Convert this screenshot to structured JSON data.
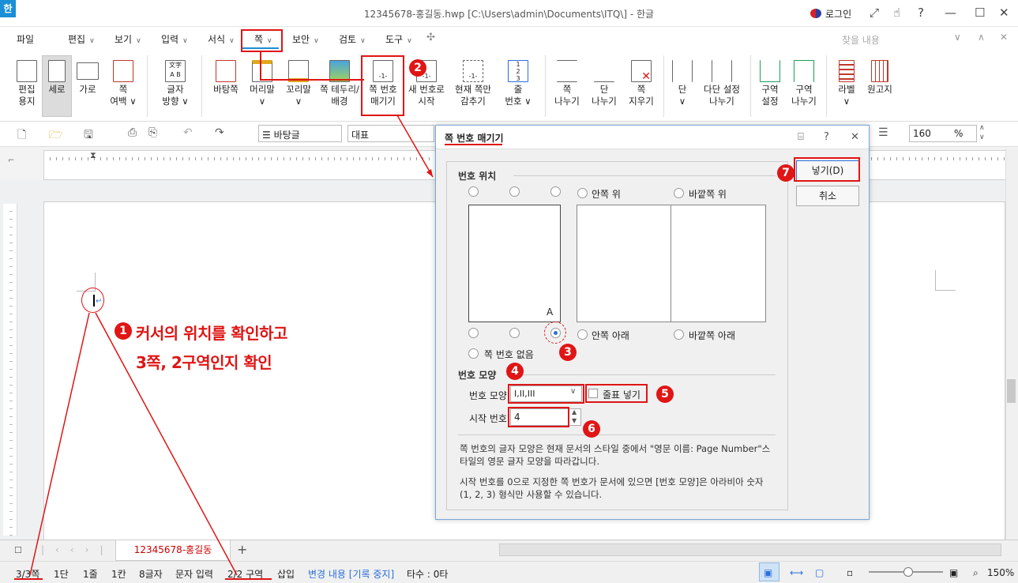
{
  "window": {
    "app_icon": "한",
    "title": "12345678-홍길동.hwp [C:\\Users\\admin\\Documents\\ITQ\\] - 한글",
    "login": "로그인",
    "help": "?"
  },
  "menu": [
    "파일",
    "편집",
    "보기",
    "입력",
    "서식",
    "쪽",
    "보안",
    "검토",
    "도구"
  ],
  "search_placeholder": "찾을 내용",
  "ribbon": [
    {
      "l1": "편집",
      "l2": "용지"
    },
    {
      "l1": "세로",
      "l2": ""
    },
    {
      "l1": "가로",
      "l2": ""
    },
    {
      "l1": "쪽",
      "l2": "여백"
    },
    {
      "l1": "글자",
      "l2": "방향"
    },
    {
      "l1": "바탕쪽",
      "l2": ""
    },
    {
      "l1": "머리말",
      "l2": ""
    },
    {
      "l1": "꼬리말",
      "l2": ""
    },
    {
      "l1": "쪽 테두리/",
      "l2": "배경"
    },
    {
      "l1": "쪽 번호",
      "l2": "매기기"
    },
    {
      "l1": "새 번호로",
      "l2": "시작"
    },
    {
      "l1": "현재 쪽만",
      "l2": "감추기"
    },
    {
      "l1": "줄",
      "l2": "번호"
    },
    {
      "l1": "쪽",
      "l2": "나누기"
    },
    {
      "l1": "단",
      "l2": "나누기"
    },
    {
      "l1": "쪽",
      "l2": "지우기"
    },
    {
      "l1": "단",
      "l2": ""
    },
    {
      "l1": "다단 설정",
      "l2": "나누기"
    },
    {
      "l1": "구역",
      "l2": "설정"
    },
    {
      "l1": "구역",
      "l2": "나누기"
    },
    {
      "l1": "라벨",
      "l2": ""
    },
    {
      "l1": "원고지",
      "l2": ""
    }
  ],
  "toolbar": {
    "style_combo": "바탕글",
    "font_combo": "대표",
    "zoom_value": "160",
    "zoom_unit": "%"
  },
  "dialog": {
    "title": "쪽 번호 매기기",
    "insert_button": "넣기(D)",
    "cancel_button": "취소",
    "position_group": "번호 위치",
    "inner_top": "안쪽 위",
    "outer_top": "바깥쪽 위",
    "inner_bottom": "안쪽 아래",
    "outer_bottom": "바깥쪽 아래",
    "no_number": "쪽 번호 없음",
    "preview_mark": "A",
    "shape_group": "번호 모양",
    "shape_label": "번호 모양",
    "shape_value": "I,II,III",
    "dash_checkbox": "줄표 넣기",
    "start_label": "시작 번호",
    "start_value": "4",
    "note1a": "쪽 번호의 글자 모양은 현재 문서의 스타일 중에서 \"영문 이름: Page Number\"스",
    "note1b": "타일의 영문 글자 모양을 따라갑니다.",
    "note2a": "시작 번호를 0으로 지정한 쪽 번호가 문서에 있으면 [번호 모양]은 아라비아 숫자",
    "note2b": "(1, 2, 3) 형식만 사용할 수 있습니다."
  },
  "annotations": {
    "b1": "1",
    "b2": "2",
    "b3": "3",
    "b4": "4",
    "b5": "5",
    "b6": "6",
    "b7": "7",
    "text1": "커서의 위치를 확인하고",
    "text2": "3쪽, 2구역인지 확인"
  },
  "doc_tab": "12345678-홍길동",
  "status": {
    "page": "3/3쪽",
    "col": "1단",
    "line": "1줄",
    "cell": "1칸",
    "chars": "8글자",
    "mode": "문자 입력",
    "section": "2/2 구역",
    "insert": "삽입",
    "track": "변경 내용 [기록 중지]",
    "strokes": "타수 : 0타",
    "zoom": "150%"
  },
  "colors": {
    "accent_red": "#e01515",
    "tab_blue": "#1a8fd6"
  }
}
